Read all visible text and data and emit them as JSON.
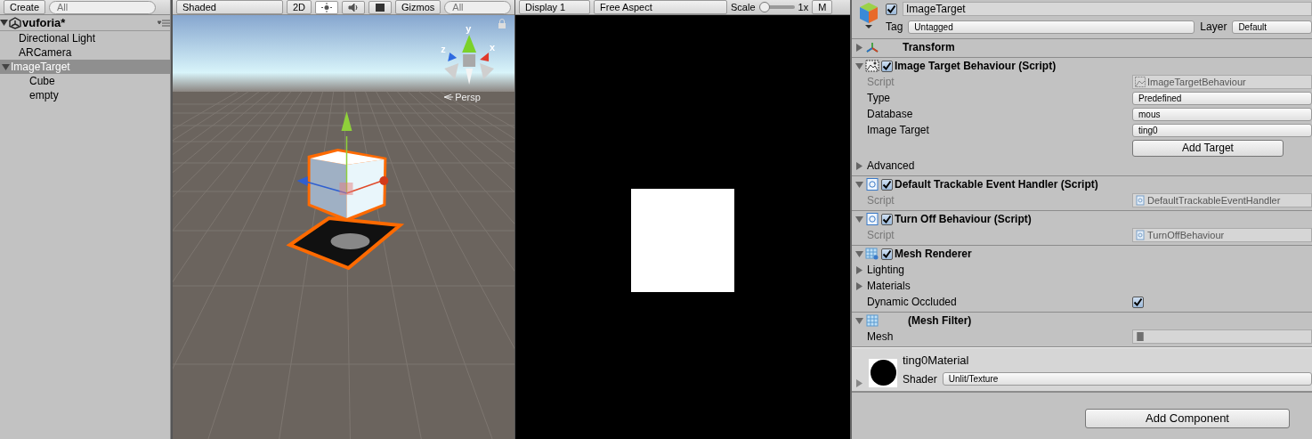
{
  "hierarchy": {
    "create_label": "Create",
    "search_placeholder": "All",
    "scene_name": "vuforia*",
    "items": [
      {
        "label": "Directional Light",
        "selected": false
      },
      {
        "label": "ARCamera",
        "selected": false
      },
      {
        "label": "ImageTarget",
        "selected": true,
        "expanded": true,
        "children": [
          {
            "label": "Cube",
            "selected": false
          },
          {
            "label": "empty",
            "selected": false
          }
        ]
      }
    ]
  },
  "scene_view": {
    "shading_mode": "Shaded",
    "mode_2d": "2D",
    "toggles": [
      {
        "kind": "lighting",
        "on": true
      },
      {
        "kind": "audio",
        "on": false
      },
      {
        "kind": "effects",
        "on": false
      }
    ],
    "gizmos": "Gizmos",
    "search_placeholder": "All",
    "axis_labels": {
      "y": "y",
      "x": "x",
      "z": "z"
    },
    "projection": "Persp"
  },
  "game_view": {
    "display": "Display 1",
    "aspect": "Free Aspect",
    "scale_label": "Scale",
    "scale": {
      "level": 0
    },
    "scale_value": "1x",
    "maximize_label": "M"
  },
  "inspector": {
    "object_name": "ImageTarget",
    "active": true,
    "tag_label": "Tag",
    "tag": "Untagged",
    "layer_label": "Layer",
    "layer": "Default",
    "components": [
      {
        "kind": "transform",
        "title": "Transform",
        "expanded": false
      },
      {
        "kind": "image_target",
        "title": "Image Target Behaviour (Script)",
        "expanded": true,
        "enabled": true,
        "rows": [
          {
            "kind": "script",
            "label": "Script",
            "value": "ImageTargetBehaviour"
          },
          {
            "kind": "dropdown",
            "label": "Type",
            "value": "Predefined"
          },
          {
            "kind": "dropdown",
            "label": "Database",
            "value": "mous"
          },
          {
            "kind": "dropdown",
            "label": "Image Target",
            "value": "ting0"
          },
          {
            "kind": "button",
            "label": "Add Target"
          },
          {
            "kind": "foldout",
            "label": "Advanced",
            "expanded": false
          }
        ]
      },
      {
        "kind": "script",
        "title": "Default Trackable Event Handler (Script)",
        "expanded": true,
        "enabled": true,
        "rows": [
          {
            "kind": "script",
            "label": "Script",
            "value": "DefaultTrackableEventHandler"
          }
        ]
      },
      {
        "kind": "script",
        "title": "Turn Off Behaviour (Script)",
        "expanded": true,
        "enabled": true,
        "rows": [
          {
            "kind": "script",
            "label": "Script",
            "value": "TurnOffBehaviour"
          }
        ]
      },
      {
        "kind": "mesh_renderer",
        "title": "Mesh Renderer",
        "expanded": true,
        "enabled": true,
        "rows": [
          {
            "kind": "foldout",
            "label": "Lighting",
            "expanded": false
          },
          {
            "kind": "foldout",
            "label": "Materials",
            "expanded": false
          },
          {
            "kind": "toggle",
            "label": "Dynamic Occluded",
            "checked": true
          }
        ]
      },
      {
        "kind": "mesh_filter",
        "title": "(Mesh Filter)",
        "expanded": true,
        "rows": [
          {
            "kind": "mesh",
            "label": "Mesh"
          }
        ]
      }
    ],
    "material": {
      "name": "ting0Material",
      "expanded": false,
      "shader_label": "Shader",
      "shader": "Unlit/Texture"
    },
    "add_component": "Add Component"
  }
}
